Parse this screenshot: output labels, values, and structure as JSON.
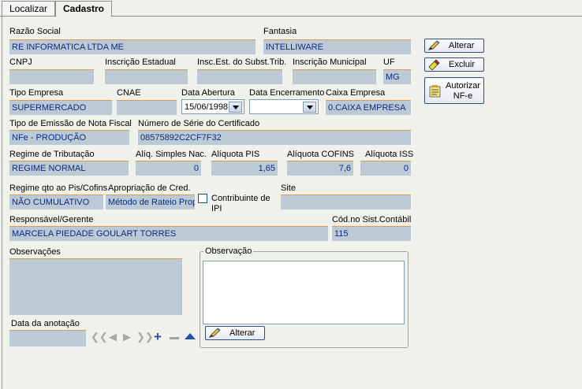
{
  "tabs": {
    "search": "Localizar",
    "record": "Cadastro"
  },
  "labels": {
    "razao_social": "Razão Social",
    "fantasia": "Fantasia",
    "cnpj": "CNPJ",
    "ie": "Inscrição Estadual",
    "ie_st": "Insc.Est. do Subst.Trib.",
    "im": "Inscrição Municipal",
    "uf": "UF",
    "tipo_empresa": "Tipo Empresa",
    "cnae": "CNAE",
    "data_abertura": "Data Abertura",
    "data_encerramento": "Data Encerramento",
    "caixa_empresa": "Caixa Empresa",
    "tipo_emissao": "Tipo de Emissão de Nota Fiscal",
    "numero_serie": "Número de Série do Certificado",
    "regime_tributacao": "Regime de Tributação",
    "aliq_simples": "Alíq. Simples Nac.",
    "aliq_pis": "Alíquota PIS",
    "aliq_cofins": "Alíquota COFINS",
    "aliq_iss": "Alíquota ISS",
    "regime_pis": "Regime qto ao Pis/Cofins",
    "apropriacao": "Apropriação de Cred.",
    "contribuinte_ipi": "Contribuinte de IPI",
    "site": "Site",
    "responsavel": "Responsável/Gerente",
    "cod_contabil": "Cód.no Sist.Contábil",
    "observacoes": "Observações",
    "observacao_group": "Observação",
    "data_anotacao": "Data da anotação"
  },
  "values": {
    "razao_social": "RE INFORMATICA LTDA ME",
    "fantasia": "INTELLIWARE",
    "cnpj": "",
    "ie": "",
    "ie_st": "",
    "im": "",
    "uf": "MG",
    "tipo_empresa": "SUPERMERCADO",
    "cnae": "",
    "data_abertura": "15/06/1998",
    "data_encerramento": "",
    "caixa_empresa": "0.CAIXA EMPRESA",
    "tipo_emissao": "NFe - PRODUÇÃO",
    "numero_serie": "08575892C2CF7F32",
    "regime_tributacao": "REGIME NORMAL",
    "aliq_simples": "0",
    "aliq_pis": "1,65",
    "aliq_cofins": "7,6",
    "aliq_iss": "0",
    "regime_pis": "NÃO CUMULATIVO",
    "apropriacao": "Método de Rateio Prop",
    "site": "",
    "responsavel": "MARCELA PIEDADE GOULART TORRES",
    "cod_contabil": "115",
    "observacoes": "",
    "observacao": "",
    "data_anotacao": ""
  },
  "buttons": {
    "alterar": "Alterar",
    "excluir": "Excluir",
    "autorizar_l1": "Autorizar",
    "autorizar_l2": "NF-e",
    "alterar_obs": "Alterar"
  },
  "icons": [
    "pencil-icon",
    "eraser-icon",
    "notes-icon",
    "first-record-icon",
    "prior-record-icon",
    "next-record-icon",
    "last-record-icon",
    "plus-icon",
    "minus-icon",
    "up-arrow-icon",
    "dropdown-arrow-icon"
  ]
}
